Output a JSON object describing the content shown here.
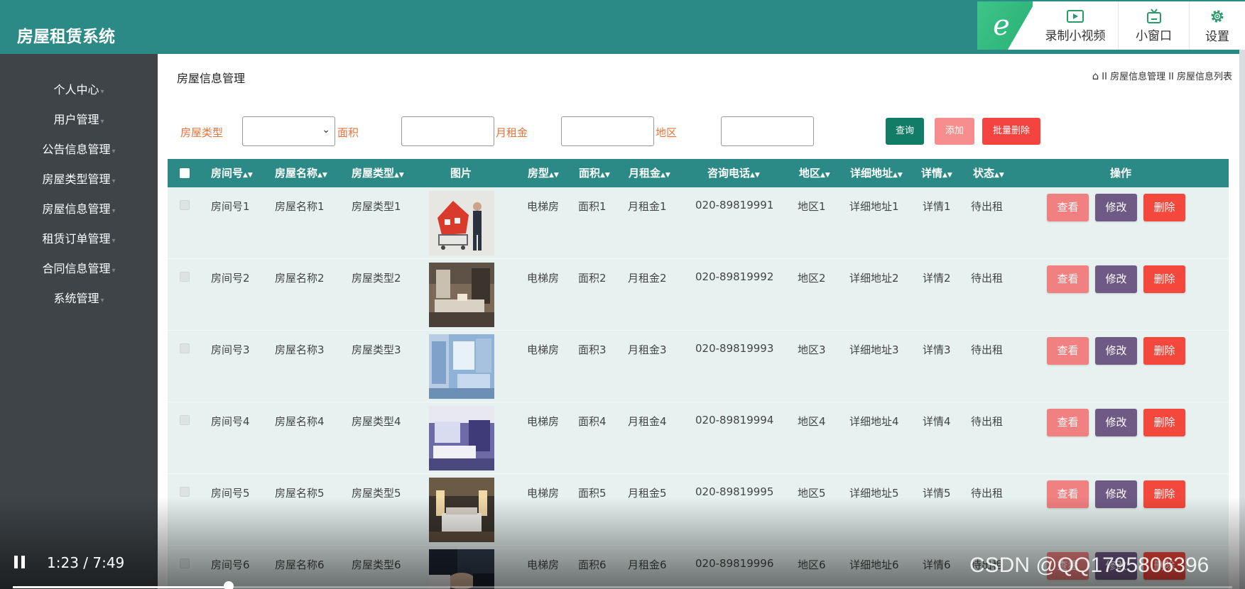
{
  "app": {
    "title": "房屋租赁系统"
  },
  "toolbar": {
    "logo": "e",
    "record_label": "录制小视频",
    "window_label": "小窗口",
    "settings_label": "设置"
  },
  "sidebar": {
    "items": [
      {
        "label": "个人中心"
      },
      {
        "label": "用户管理"
      },
      {
        "label": "公告信息管理"
      },
      {
        "label": "房屋类型管理"
      },
      {
        "label": "房屋信息管理"
      },
      {
        "label": "租赁订单管理"
      },
      {
        "label": "合同信息管理"
      },
      {
        "label": "系统管理"
      }
    ]
  },
  "page": {
    "title": "房屋信息管理",
    "breadcrumb": "II 房屋信息管理 II 房屋信息列表"
  },
  "filters": {
    "type_label": "房屋类型",
    "area_label": "面积",
    "rent_label": "月租金",
    "region_label": "地区",
    "type_value": "",
    "area_value": "",
    "rent_value": "",
    "region_value": ""
  },
  "buttons": {
    "query": "查询",
    "add": "添加",
    "batch_delete": "批量删除"
  },
  "table": {
    "headers": {
      "room_no": "房间号",
      "name": "房屋名称",
      "type": "房屋类型",
      "image": "图片",
      "layout": "房型",
      "area": "面积",
      "rent": "月租金",
      "phone": "咨询电话",
      "region": "地区",
      "address": "详细地址",
      "detail": "详情",
      "status": "状态",
      "actions": "操作"
    },
    "sort_icon": "▲▼",
    "action_labels": {
      "view": "查看",
      "edit": "修改",
      "delete": "删除"
    },
    "rows": [
      {
        "room_no": "房间号1",
        "name": "房屋名称1",
        "type": "房屋类型1",
        "layout": "电梯房",
        "area": "面积1",
        "rent": "月租金1",
        "phone": "020-89819991",
        "region": "地区1",
        "address": "详细地址1",
        "detail": "详情1",
        "status": "待出租"
      },
      {
        "room_no": "房间号2",
        "name": "房屋名称2",
        "type": "房屋类型2",
        "layout": "电梯房",
        "area": "面积2",
        "rent": "月租金2",
        "phone": "020-89819992",
        "region": "地区2",
        "address": "详细地址2",
        "detail": "详情2",
        "status": "待出租"
      },
      {
        "room_no": "房间号3",
        "name": "房屋名称3",
        "type": "房屋类型3",
        "layout": "电梯房",
        "area": "面积3",
        "rent": "月租金3",
        "phone": "020-89819993",
        "region": "地区3",
        "address": "详细地址3",
        "detail": "详情3",
        "status": "待出租"
      },
      {
        "room_no": "房间号4",
        "name": "房屋名称4",
        "type": "房屋类型4",
        "layout": "电梯房",
        "area": "面积4",
        "rent": "月租金4",
        "phone": "020-89819994",
        "region": "地区4",
        "address": "详细地址4",
        "detail": "详情4",
        "status": "待出租"
      },
      {
        "room_no": "房间号5",
        "name": "房屋名称5",
        "type": "房屋类型5",
        "layout": "电梯房",
        "area": "面积5",
        "rent": "月租金5",
        "phone": "020-89819995",
        "region": "地区5",
        "address": "详细地址5",
        "detail": "详情5",
        "status": "待出租"
      },
      {
        "room_no": "房间号6",
        "name": "房屋名称6",
        "type": "房屋类型6",
        "layout": "电梯房",
        "area": "面积6",
        "rent": "月租金6",
        "phone": "020-89819996",
        "region": "地区6",
        "address": "详细地址6",
        "detail": "详情6",
        "status": "待出租"
      }
    ]
  },
  "video": {
    "time": "1:23 / 7:49",
    "progress": 0.177
  },
  "watermark": "CSDN @QQ1795806396",
  "colors": {
    "header": "#2c8a86",
    "sidebar": "#3f4448",
    "row": "#e7f2f0",
    "label": "#e9723a",
    "query": "#127d66",
    "add": "#f68e8e",
    "delete": "#f5433f",
    "edit": "#6e5a84"
  }
}
